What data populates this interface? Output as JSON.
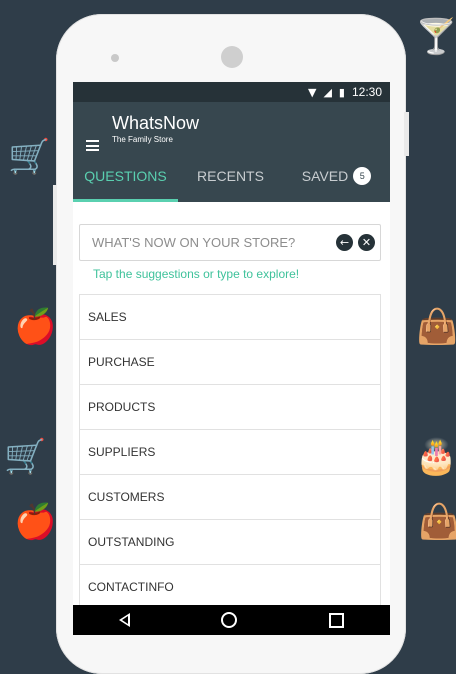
{
  "status_bar": {
    "time": "12:30"
  },
  "app_bar": {
    "title": "WhatsNow",
    "subtitle": "The Family Store"
  },
  "tabs": [
    {
      "label": "QUESTIONS",
      "active": true
    },
    {
      "label": "RECENTS",
      "active": false
    },
    {
      "label": "SAVED",
      "active": false,
      "badge": "5"
    }
  ],
  "search": {
    "placeholder": "WHAT'S NOW ON YOUR STORE?",
    "value": ""
  },
  "hint": "Tap the suggestions or type to explore!",
  "suggestions": [
    "SALES",
    "PURCHASE",
    "PRODUCTS",
    "SUPPLIERS",
    "CUSTOMERS",
    "OUTSTANDING",
    "CONTACTINFO"
  ],
  "colors": {
    "accent": "#5ad0b0",
    "app_bar": "#37474f",
    "status_bar": "#263238",
    "background": "#2f3d49"
  }
}
